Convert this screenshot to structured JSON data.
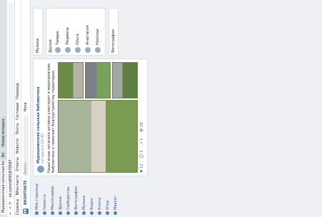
{
  "browser": {
    "tabs": [
      "Мурашкинская сельская библиотека",
      "Вк",
      "Новая вкладка"
    ],
    "url": "vk.com/id591870587",
    "bookmarks": [
      "Сервисы",
      "ВКонтакте",
      "Ответы",
      "Новости",
      "Почта",
      "Гостевая",
      "Перевод"
    ]
  },
  "header": {
    "brand": "ВКОНТАКТЕ",
    "search_placeholder": "Поиск",
    "user": "Ника"
  },
  "menu": [
    "Моя страница",
    "Новости",
    "Мессенджер",
    "Друзья",
    "Сообщества",
    "Фотографии",
    "Музыка",
    "Видео",
    "Клипы",
    "Игры",
    "Маркет"
  ],
  "post": {
    "author": "Мурашкинская сельская библиотека",
    "time": "сегодня в 10:45",
    "text": "Наши юные читатели активно участвуют в мероприятиях библиотеки и помогают благоустройству территории.",
    "likes": "12",
    "comments": "3",
    "shares": "1",
    "views": "58"
  },
  "right": {
    "promo": "Музыка",
    "friends_title": "Друзья",
    "friends": [
      "Тамара",
      "Людмила",
      "Ольга",
      "Анастасия",
      "Николай"
    ],
    "photos_title": "Фотографии"
  }
}
